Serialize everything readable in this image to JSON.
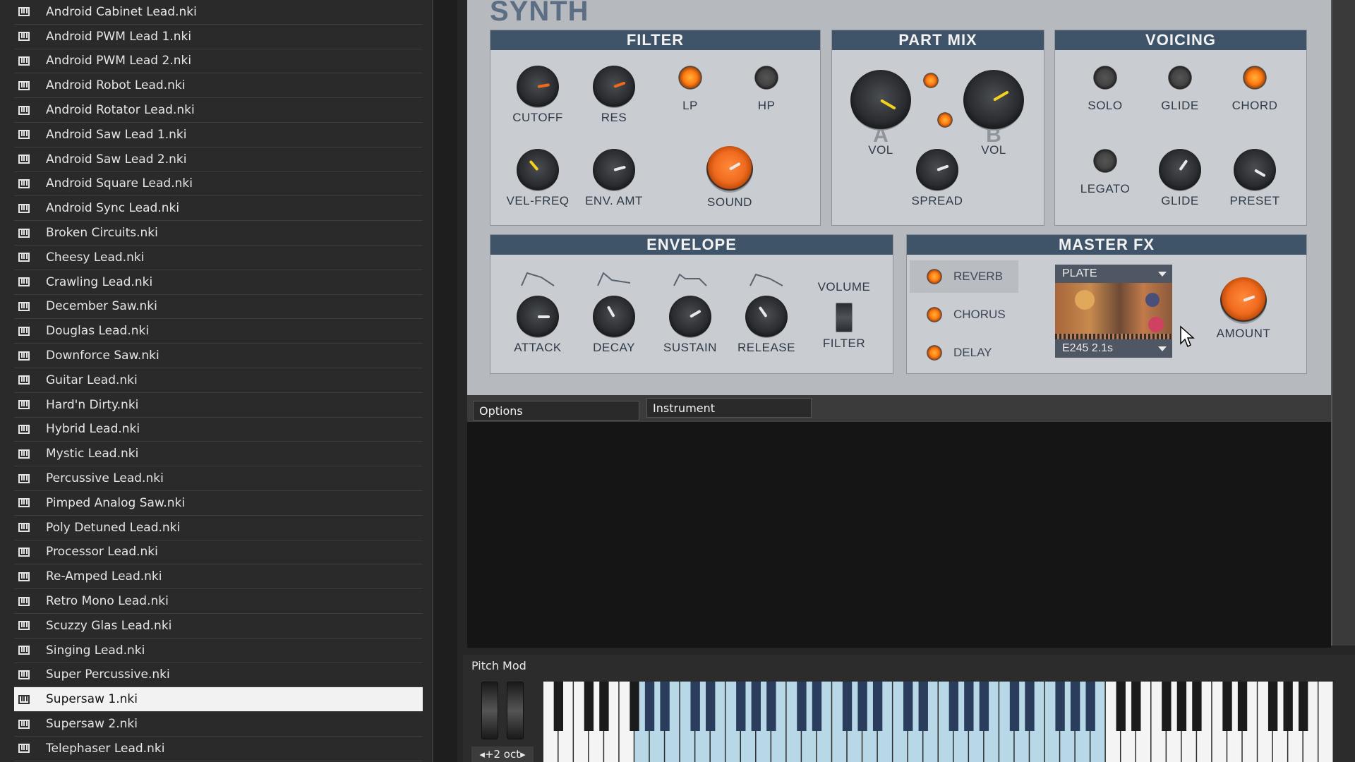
{
  "browser": {
    "files": [
      "Android Cabinet Lead.nki",
      "Android PWM Lead 1.nki",
      "Android PWM Lead 2.nki",
      "Android Robot Lead.nki",
      "Android Rotator Lead.nki",
      "Android Saw Lead 1.nki",
      "Android Saw Lead 2.nki",
      "Android Square Lead.nki",
      "Android Sync Lead.nki",
      "Broken Circuits.nki",
      "Cheesy Lead.nki",
      "Crawling Lead.nki",
      "December Saw.nki",
      "Douglas Lead.nki",
      "Downforce Saw.nki",
      "Guitar Lead.nki",
      "Hard'n Dirty.nki",
      "Hybrid Lead.nki",
      "Mystic Lead.nki",
      "Percussive Lead.nki",
      "Pimped Analog Saw.nki",
      "Poly Detuned Lead.nki",
      "Processor Lead.nki",
      "Re-Amped Lead.nki",
      "Retro Mono Lead.nki",
      "Scuzzy Glas Lead.nki",
      "Singing Lead.nki",
      "Super Percussive.nki",
      "Supersaw 1.nki",
      "Supersaw 2.nki",
      "Telephaser Lead.nki"
    ],
    "selected_index": 28
  },
  "synth": {
    "title": "SYNTH",
    "filter": {
      "header": "FILTER",
      "cutoff": "CUTOFF",
      "res": "RES",
      "lp": "LP",
      "hp": "HP",
      "vel_freq": "VEL-FREQ",
      "env_amt": "ENV. AMT",
      "sound": "SOUND"
    },
    "part_mix": {
      "header": "PART MIX",
      "a_letter": "A",
      "b_letter": "B",
      "vol_a": "VOL",
      "vol_b": "VOL",
      "spread": "SPREAD"
    },
    "voicing": {
      "header": "VOICING",
      "solo": "SOLO",
      "glide_btn": "GLIDE",
      "chord": "CHORD",
      "legato": "LEGATO",
      "glide_knob": "GLIDE",
      "preset": "PRESET"
    },
    "envelope": {
      "header": "ENVELOPE",
      "attack": "ATTACK",
      "decay": "DECAY",
      "sustain": "SUSTAIN",
      "release": "RELEASE",
      "volume": "VOLUME",
      "filter": "FILTER"
    },
    "master_fx": {
      "header": "MASTER FX",
      "reverb": "REVERB",
      "chorus": "CHORUS",
      "delay": "DELAY",
      "reverb_type": "PLATE",
      "reverb_preset": "E245 2.1s",
      "amount": "AMOUNT"
    }
  },
  "tabs": {
    "options": "Options",
    "instrument": "Instrument"
  },
  "keyboard": {
    "label": "Pitch Mod",
    "octave": "◂+2 oct▸"
  },
  "colors": {
    "header": "#3f5369",
    "panel": "#c9ccd1",
    "led_on": "#ff7a10",
    "knob_orange": "#f06a1e"
  }
}
